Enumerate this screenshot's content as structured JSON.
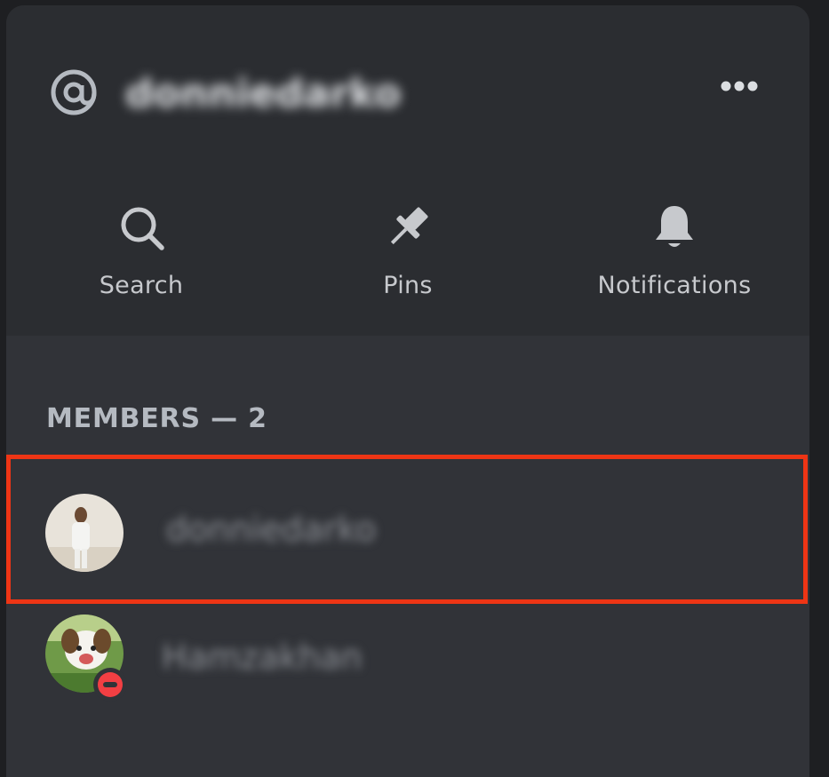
{
  "header": {
    "channel_name": "donniedarko",
    "at_icon": "at-icon",
    "more_icon": "more-icon"
  },
  "actions": [
    {
      "label": "Search",
      "icon": "search-icon"
    },
    {
      "label": "Pins",
      "icon": "pin-icon"
    },
    {
      "label": "Notifications",
      "icon": "bell-icon"
    }
  ],
  "members": {
    "header": "MEMBERS — 2",
    "list": [
      {
        "name": "donniedarko",
        "status": "none",
        "highlighted": true
      },
      {
        "name": "Hamzakhan",
        "status": "do-not-disturb",
        "highlighted": false
      }
    ]
  },
  "colors": {
    "panel_top": "#2b2d31",
    "panel_bottom": "#313338",
    "highlight_border": "#ee3515",
    "dnd_status": "#f23f43",
    "text_muted": "#b5bac1"
  }
}
